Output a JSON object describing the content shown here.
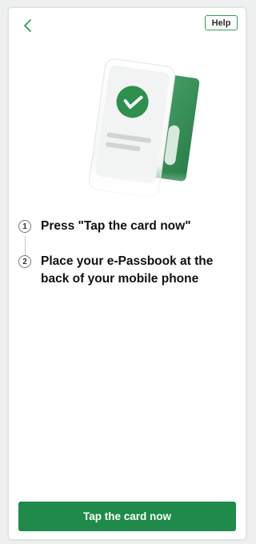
{
  "header": {
    "back_icon": "chevron-left-icon",
    "help_label": "Help"
  },
  "hero": {
    "illustration": "phone-with-card-check-icon"
  },
  "steps": [
    {
      "number": "1",
      "text": "Press \"Tap the card now\""
    },
    {
      "number": "2",
      "text": "Place your e-Passbook at the back of your mobile phone"
    }
  ],
  "footer": {
    "cta_label": "Tap the card now"
  },
  "colors": {
    "brand_green": "#1f8a4a",
    "card_green": "#3d9a5f",
    "check_green": "#2f8f4e"
  }
}
